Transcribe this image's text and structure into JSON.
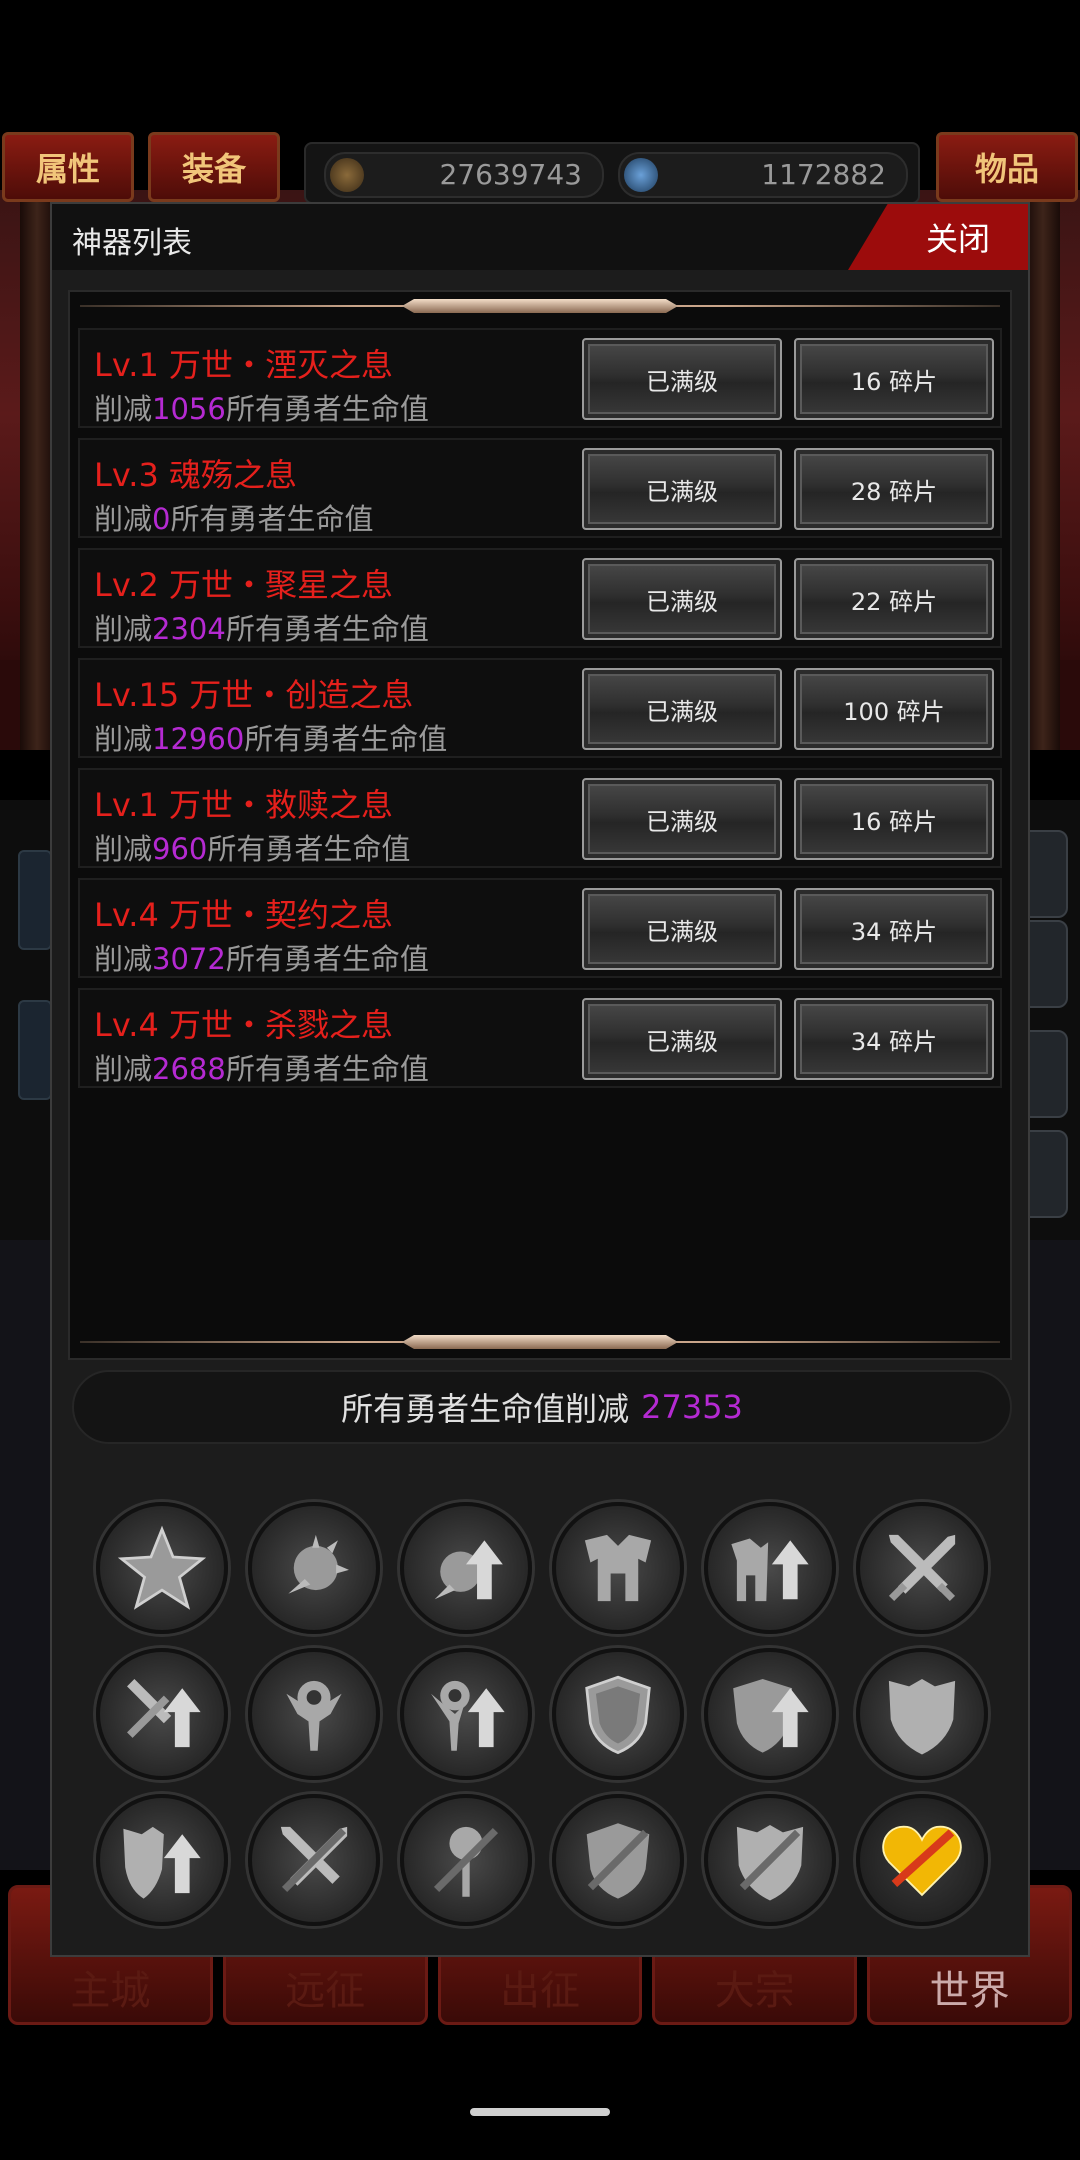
{
  "hud": {
    "tabs": [
      "属性",
      "装备",
      "物品"
    ],
    "gold": "27639743",
    "gems": "1172882"
  },
  "panel": {
    "title": "神器列表",
    "close_label": "关闭"
  },
  "artifacts": [
    {
      "title": "Lv.1 万世・湮灭之息",
      "desc_prefix": "削减",
      "value": "1056",
      "desc_suffix": "所有勇者生命值",
      "status": "已满级",
      "fragments": "16 碎片"
    },
    {
      "title": "Lv.3 魂殇之息",
      "desc_prefix": "削减",
      "value": "0",
      "desc_suffix": "所有勇者生命值",
      "status": "已满级",
      "fragments": "28 碎片"
    },
    {
      "title": "Lv.2 万世・聚星之息",
      "desc_prefix": "削减",
      "value": "2304",
      "desc_suffix": "所有勇者生命值",
      "status": "已满级",
      "fragments": "22 碎片"
    },
    {
      "title": "Lv.15 万世・创造之息",
      "desc_prefix": "削减",
      "value": "12960",
      "desc_suffix": "所有勇者生命值",
      "status": "已满级",
      "fragments": "100 碎片"
    },
    {
      "title": "Lv.1 万世・救赎之息",
      "desc_prefix": "削减",
      "value": "960",
      "desc_suffix": "所有勇者生命值",
      "status": "已满级",
      "fragments": "16 碎片"
    },
    {
      "title": "Lv.4 万世・契约之息",
      "desc_prefix": "削减",
      "value": "3072",
      "desc_suffix": "所有勇者生命值",
      "status": "已满级",
      "fragments": "34 碎片"
    },
    {
      "title": "Lv.4 万世・杀戮之息",
      "desc_prefix": "削减",
      "value": "2688",
      "desc_suffix": "所有勇者生命值",
      "status": "已满级",
      "fragments": "34 碎片"
    }
  ],
  "total": {
    "label": "所有勇者生命值削减",
    "value": "27353"
  },
  "category_icons": [
    "star-icon",
    "spiked-ball-icon",
    "spiked-ball-up-icon",
    "armor-icon",
    "armor-up-icon",
    "crossed-swords-icon",
    "sword-up-icon",
    "orb-staff-icon",
    "orb-staff-up-icon",
    "shield-icon",
    "shield-up-icon",
    "crest-shield-icon",
    "crest-shield-up-icon",
    "crossed-swords-break-icon",
    "orb-break-icon",
    "shield-break-icon",
    "crest-break-icon",
    "heart-break-icon"
  ],
  "background_nav": [
    "主城",
    "远征",
    "出征",
    "大宗",
    "世界"
  ],
  "colors": {
    "title_red": "#e5201c",
    "value_purple": "#b52ad2",
    "close_red": "#9c0c0c",
    "active_icon_gold": "#f2b705"
  }
}
